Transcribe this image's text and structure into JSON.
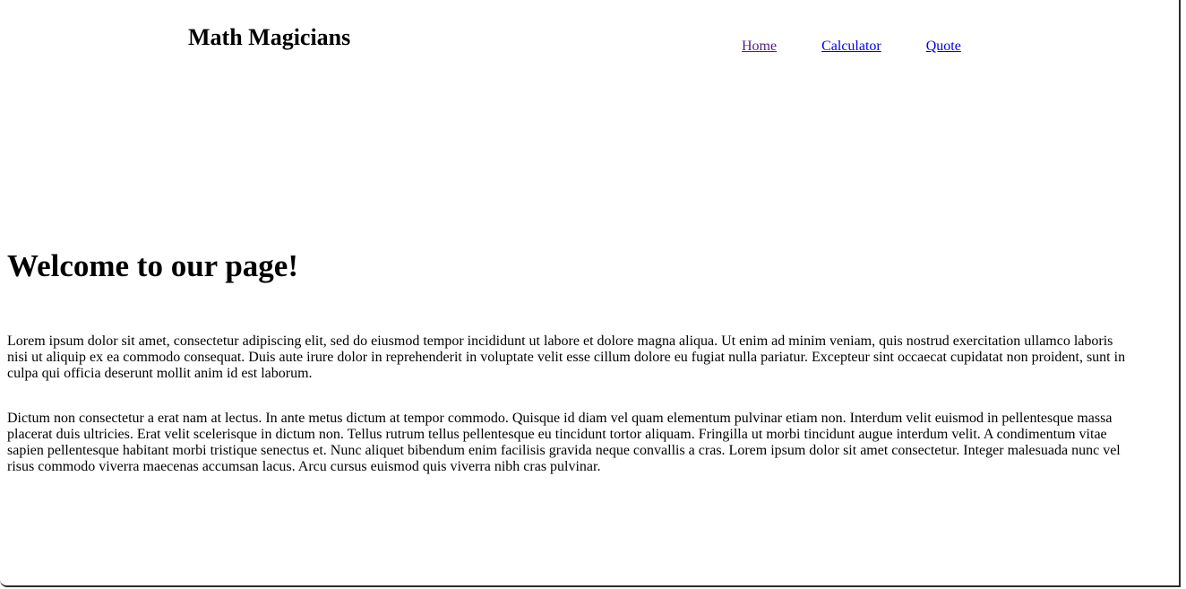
{
  "header": {
    "brand": "Math Magicians",
    "nav": [
      {
        "label": "Home"
      },
      {
        "label": "Calculator"
      },
      {
        "label": "Quote"
      }
    ]
  },
  "main": {
    "heading": "Welcome to our page!",
    "paragraphs": [
      "Lorem ipsum dolor sit amet, consectetur adipiscing elit, sed do eiusmod tempor incididunt ut labore et dolore magna aliqua. Ut enim ad minim veniam, quis nostrud exercitation ullamco laboris nisi ut aliquip ex ea commodo consequat. Duis aute irure dolor in reprehenderit in voluptate velit esse cillum dolore eu fugiat nulla pariatur. Excepteur sint occaecat cupidatat non proident, sunt in culpa qui officia deserunt mollit anim id est laborum.",
      "Dictum non consectetur a erat nam at lectus. In ante metus dictum at tempor commodo. Quisque id diam vel quam elementum pulvinar etiam non. Interdum velit euismod in pellentesque massa placerat duis ultricies. Erat velit scelerisque in dictum non. Tellus rutrum tellus pellentesque eu tincidunt tortor aliquam. Fringilla ut morbi tincidunt augue interdum velit. A condimentum vitae sapien pellentesque habitant morbi tristique senectus et. Nunc aliquet bibendum enim facilisis gravida neque convallis a cras. Lorem ipsum dolor sit amet consectetur. Integer malesuada nunc vel risus commodo viverra maecenas accumsan lacus. Arcu cursus euismod quis viverra nibh cras pulvinar."
    ]
  },
  "colors": {
    "visited_link": "#551a8b",
    "link": "#0000ee",
    "text": "#000000",
    "background": "#ffffff"
  }
}
